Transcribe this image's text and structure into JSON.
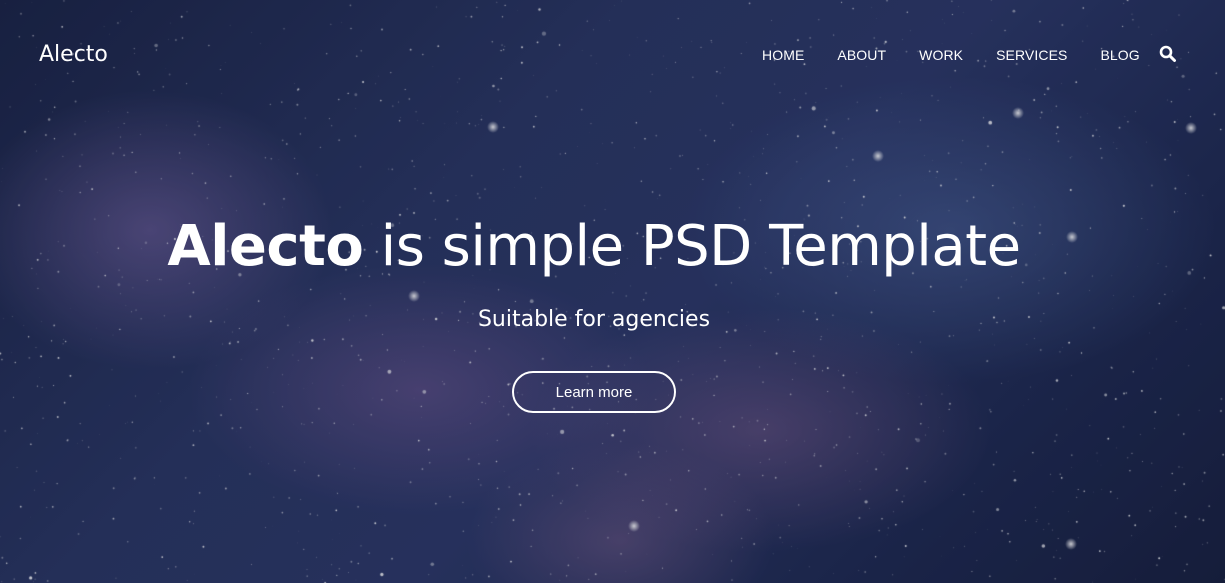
{
  "site": {
    "logo": "Alecto"
  },
  "nav": {
    "items": [
      {
        "label": "HOME"
      },
      {
        "label": "ABOUT"
      },
      {
        "label": "WORK"
      },
      {
        "label": "SERVICES"
      },
      {
        "label": "BLOG"
      }
    ],
    "search_icon": "search-icon"
  },
  "hero": {
    "headline_brand": "Alecto",
    "headline_rest": " is simple PSD Template",
    "subtitle": "Suitable for agencies",
    "cta_label": "Learn more"
  },
  "colors": {
    "text": "#ffffff",
    "background_dark": "#1b2446",
    "background_mid": "#2c3868"
  }
}
